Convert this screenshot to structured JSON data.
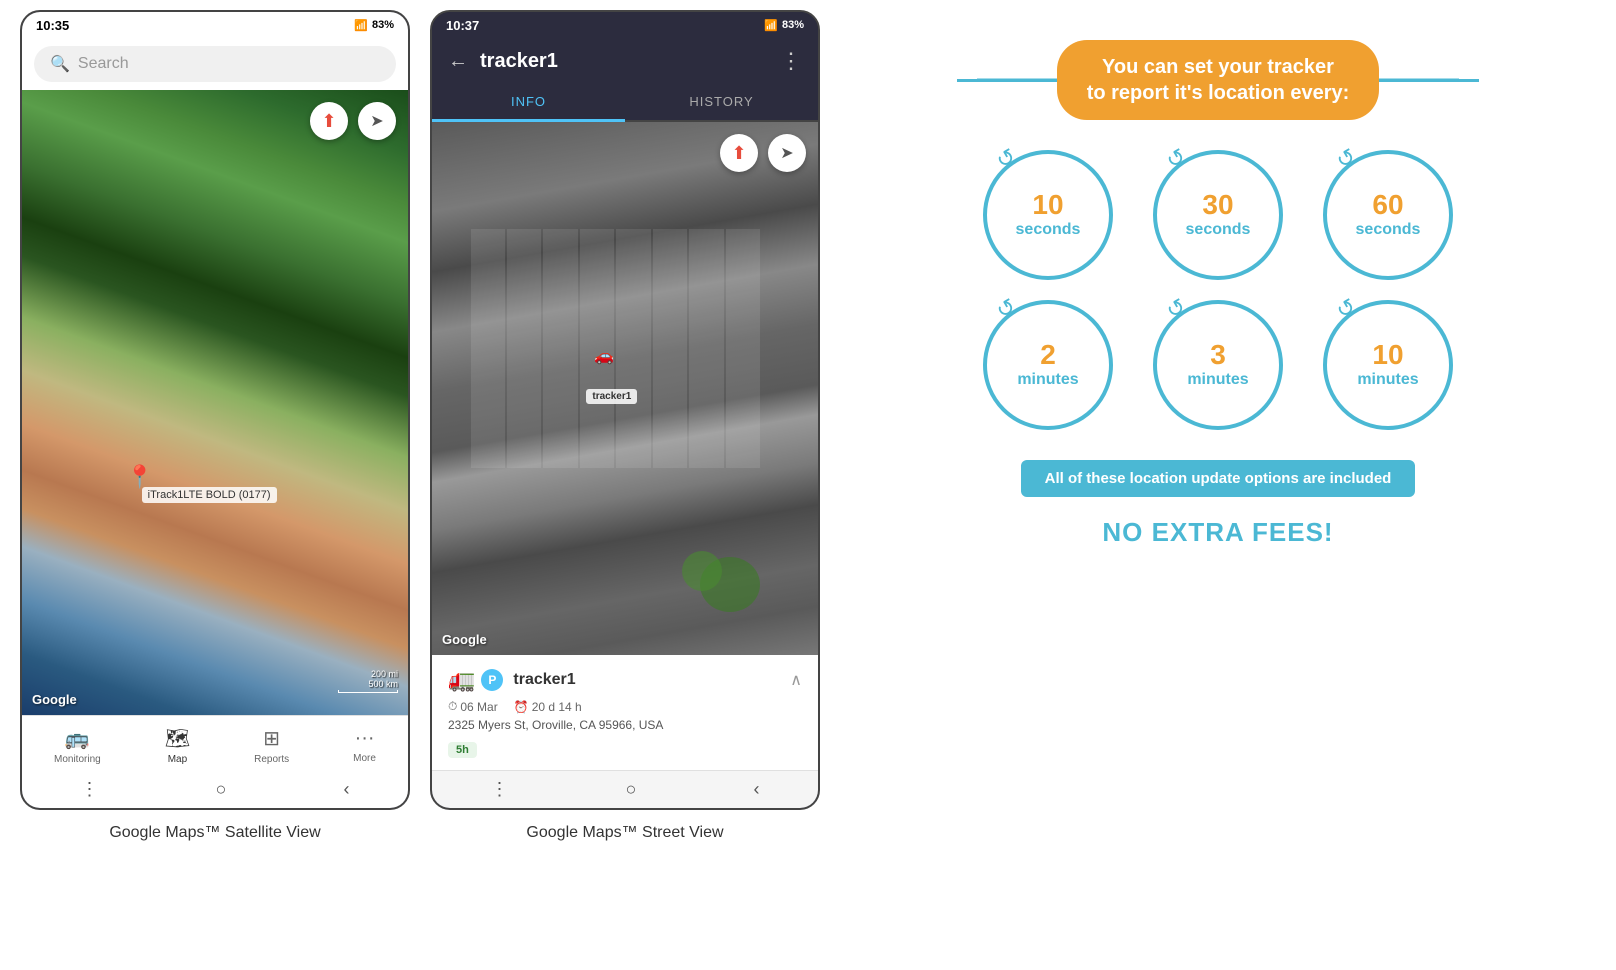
{
  "phone1": {
    "statusBar": {
      "time": "10:35",
      "battery": "83%",
      "icons": "▲▲▲"
    },
    "search": {
      "placeholder": "Search"
    },
    "map": {
      "type": "satellite",
      "googleWatermark": "Google",
      "scaleMi": "200 mi",
      "scaleKm": "500 km",
      "trackerLabel": "iTrack1LTE BOLD (0177)"
    },
    "nav": {
      "items": [
        {
          "icon": "🚌",
          "label": "Monitoring",
          "active": false
        },
        {
          "icon": "🗺",
          "label": "Map",
          "active": true
        },
        {
          "icon": "📊",
          "label": "Reports",
          "active": false
        },
        {
          "icon": "···",
          "label": "More",
          "active": false
        }
      ]
    },
    "caption": "Google Maps™ Satellite View"
  },
  "phone2": {
    "statusBar": {
      "time": "10:37",
      "battery": "83%"
    },
    "header": {
      "title": "tracker1",
      "backLabel": "←",
      "moreLabel": "⋮"
    },
    "tabs": [
      {
        "label": "INFO",
        "active": true
      },
      {
        "label": "HISTORY",
        "active": false
      }
    ],
    "map": {
      "type": "street",
      "googleWatermark": "Google"
    },
    "trackerInfo": {
      "name": "tracker1",
      "pBadge": "P",
      "date": "06 Mar",
      "duration": "20 d 14 h",
      "address": "2325 Myers St, Oroville, CA 95966, USA",
      "timeBadge": "5h",
      "trackerLabel": "tracker1"
    },
    "caption": "Google Maps™ Street View"
  },
  "infographic": {
    "bannerText": "You can set your tracker\nto report it's location every:",
    "circles": [
      {
        "number": "10",
        "unit": "seconds"
      },
      {
        "number": "30",
        "unit": "seconds"
      },
      {
        "number": "60",
        "unit": "seconds"
      },
      {
        "number": "2",
        "unit": "minutes"
      },
      {
        "number": "3",
        "unit": "minutes"
      },
      {
        "number": "10",
        "unit": "minutes"
      }
    ],
    "noticeBannerText": "All of these location update options are included",
    "noFeesText": "NO EXTRA FEES!"
  }
}
